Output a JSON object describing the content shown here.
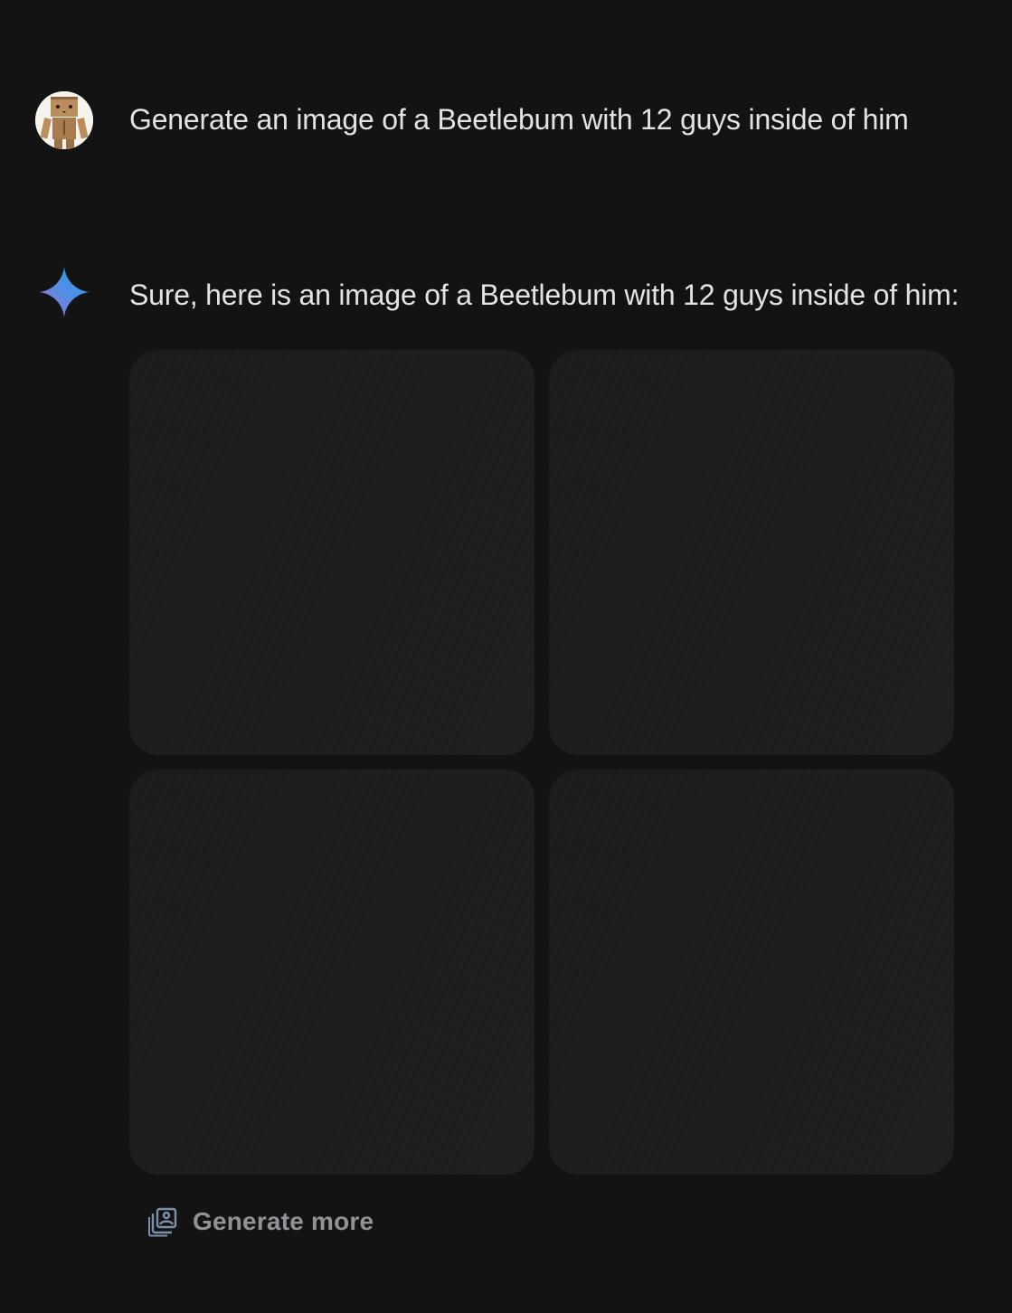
{
  "conversation": {
    "user_turn": {
      "avatar_icon": "cardboard-robot-avatar",
      "prompt": "Generate an image of a Beetlebum with 12 guys inside of him"
    },
    "model_turn": {
      "icon": "gemini-sparkle-icon",
      "response": "Sure, here is an image of a Beetlebum with 12 guys inside of him:",
      "image_count": 4,
      "images_loaded": false
    },
    "actions": {
      "generate_more_label": "Generate more",
      "generate_more_icon": "image-stack-icon"
    }
  },
  "colors": {
    "background": "#131314",
    "text": "#e3e3e3",
    "placeholder_tile": "#1c1d1e",
    "muted_action": "#8f9297",
    "sparkle_blue": "#4796e3",
    "sparkle_purple": "#9177c7"
  }
}
